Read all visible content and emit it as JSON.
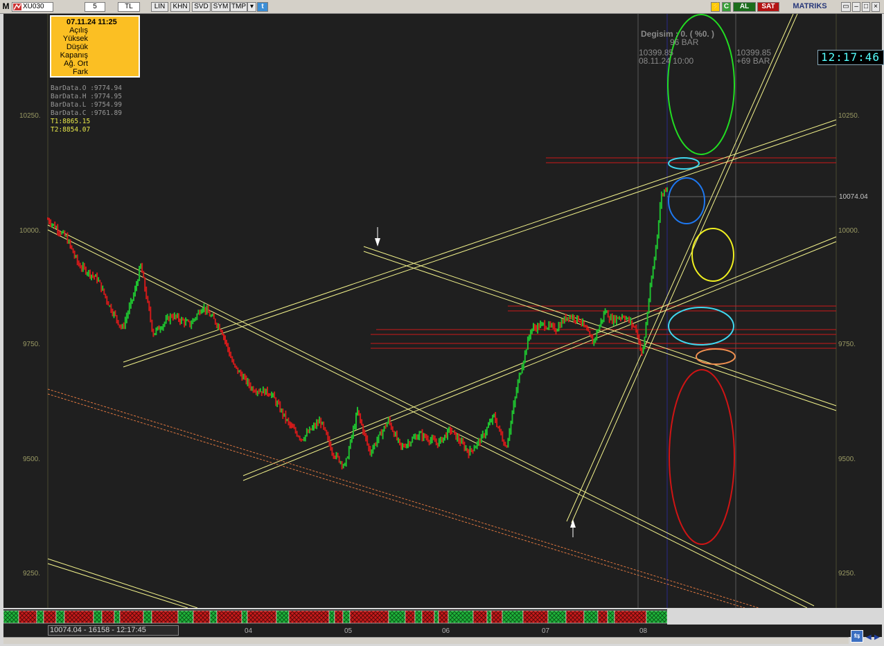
{
  "toolbar": {
    "menu_letter": "M",
    "symbol": "XU030",
    "period": "5",
    "currency": "TL",
    "buttons": [
      "LIN",
      "KHN",
      "SVD",
      "SYM",
      "TMP"
    ],
    "buy_label": "AL",
    "sell_label": "SAT",
    "brand": "MATRIKS"
  },
  "info_box": {
    "datetime": "07.11.24 11:25",
    "rows": [
      "Açılış",
      "Yüksek",
      "Düşük",
      "Kapanış",
      "Ağ. Ort",
      "Fark"
    ]
  },
  "bar_data": {
    "open": "BarData.O :9774.94",
    "high": "BarData.H :9774.95",
    "low": "BarData.L :9754.99",
    "close": "BarData.C :9761.89"
  },
  "targets": {
    "t1": "T1:8865.15",
    "t2": "T2:8854.07"
  },
  "overlay": {
    "change": "Degisim : 0. ( %0. )",
    "bars": "96 BAR",
    "left_price": "10399.85",
    "left_date": "08.11.24 10:00",
    "right_price": "10399.85",
    "right_bars": "+69 BAR"
  },
  "clock": "12:17:46",
  "last_price": "10074.04",
  "y_axis_labels": [
    "10250.",
    "10000.",
    "9750.",
    "9500.",
    "9250."
  ],
  "x_axis_labels": [
    "04",
    "05",
    "06",
    "07",
    "08"
  ],
  "status_readout": "10074.04 - 16158 - 12:17:45",
  "colors": {
    "background": "#1f1f1f",
    "up_candle": "#1fbf2f",
    "down_candle": "#d01a1a",
    "trendline": "#f4f48c",
    "info_box": "#fbbf23",
    "ellipse_green": "#22dd22",
    "ellipse_cyan": "#40d8f0",
    "ellipse_blue": "#1e78f0",
    "ellipse_yellow": "#f0f020",
    "ellipse_orange": "#f09050",
    "ellipse_red": "#d01414"
  },
  "chart_data": {
    "type": "line",
    "y_range": [
      9150,
      10450
    ],
    "x_categories": [
      "04",
      "05",
      "06",
      "07",
      "08"
    ],
    "price_path": [
      [
        0,
        10000
      ],
      [
        0.03,
        9960
      ],
      [
        0.05,
        9900
      ],
      [
        0.08,
        9870
      ],
      [
        0.1,
        9810
      ],
      [
        0.12,
        9760
      ],
      [
        0.14,
        9840
      ],
      [
        0.15,
        9900
      ],
      [
        0.17,
        9750
      ],
      [
        0.2,
        9790
      ],
      [
        0.23,
        9770
      ],
      [
        0.25,
        9810
      ],
      [
        0.28,
        9760
      ],
      [
        0.3,
        9680
      ],
      [
        0.33,
        9630
      ],
      [
        0.36,
        9620
      ],
      [
        0.39,
        9550
      ],
      [
        0.41,
        9520
      ],
      [
        0.44,
        9560
      ],
      [
        0.46,
        9490
      ],
      [
        0.48,
        9460
      ],
      [
        0.5,
        9580
      ],
      [
        0.52,
        9490
      ],
      [
        0.55,
        9560
      ],
      [
        0.57,
        9500
      ],
      [
        0.6,
        9530
      ],
      [
        0.63,
        9510
      ],
      [
        0.65,
        9540
      ],
      [
        0.68,
        9490
      ],
      [
        0.7,
        9520
      ],
      [
        0.72,
        9570
      ],
      [
        0.74,
        9500
      ],
      [
        0.76,
        9650
      ],
      [
        0.78,
        9760
      ],
      [
        0.8,
        9770
      ],
      [
        0.82,
        9760
      ],
      [
        0.84,
        9790
      ],
      [
        0.86,
        9780
      ],
      [
        0.88,
        9730
      ],
      [
        0.9,
        9800
      ],
      [
        0.91,
        9780
      ],
      [
        0.93,
        9790
      ],
      [
        0.95,
        9760
      ],
      [
        0.96,
        9700
      ],
      [
        0.97,
        9820
      ],
      [
        0.98,
        9920
      ],
      [
        0.985,
        9980
      ],
      [
        0.99,
        10050
      ],
      [
        1.0,
        10074
      ]
    ],
    "last_value": 10074.04
  }
}
